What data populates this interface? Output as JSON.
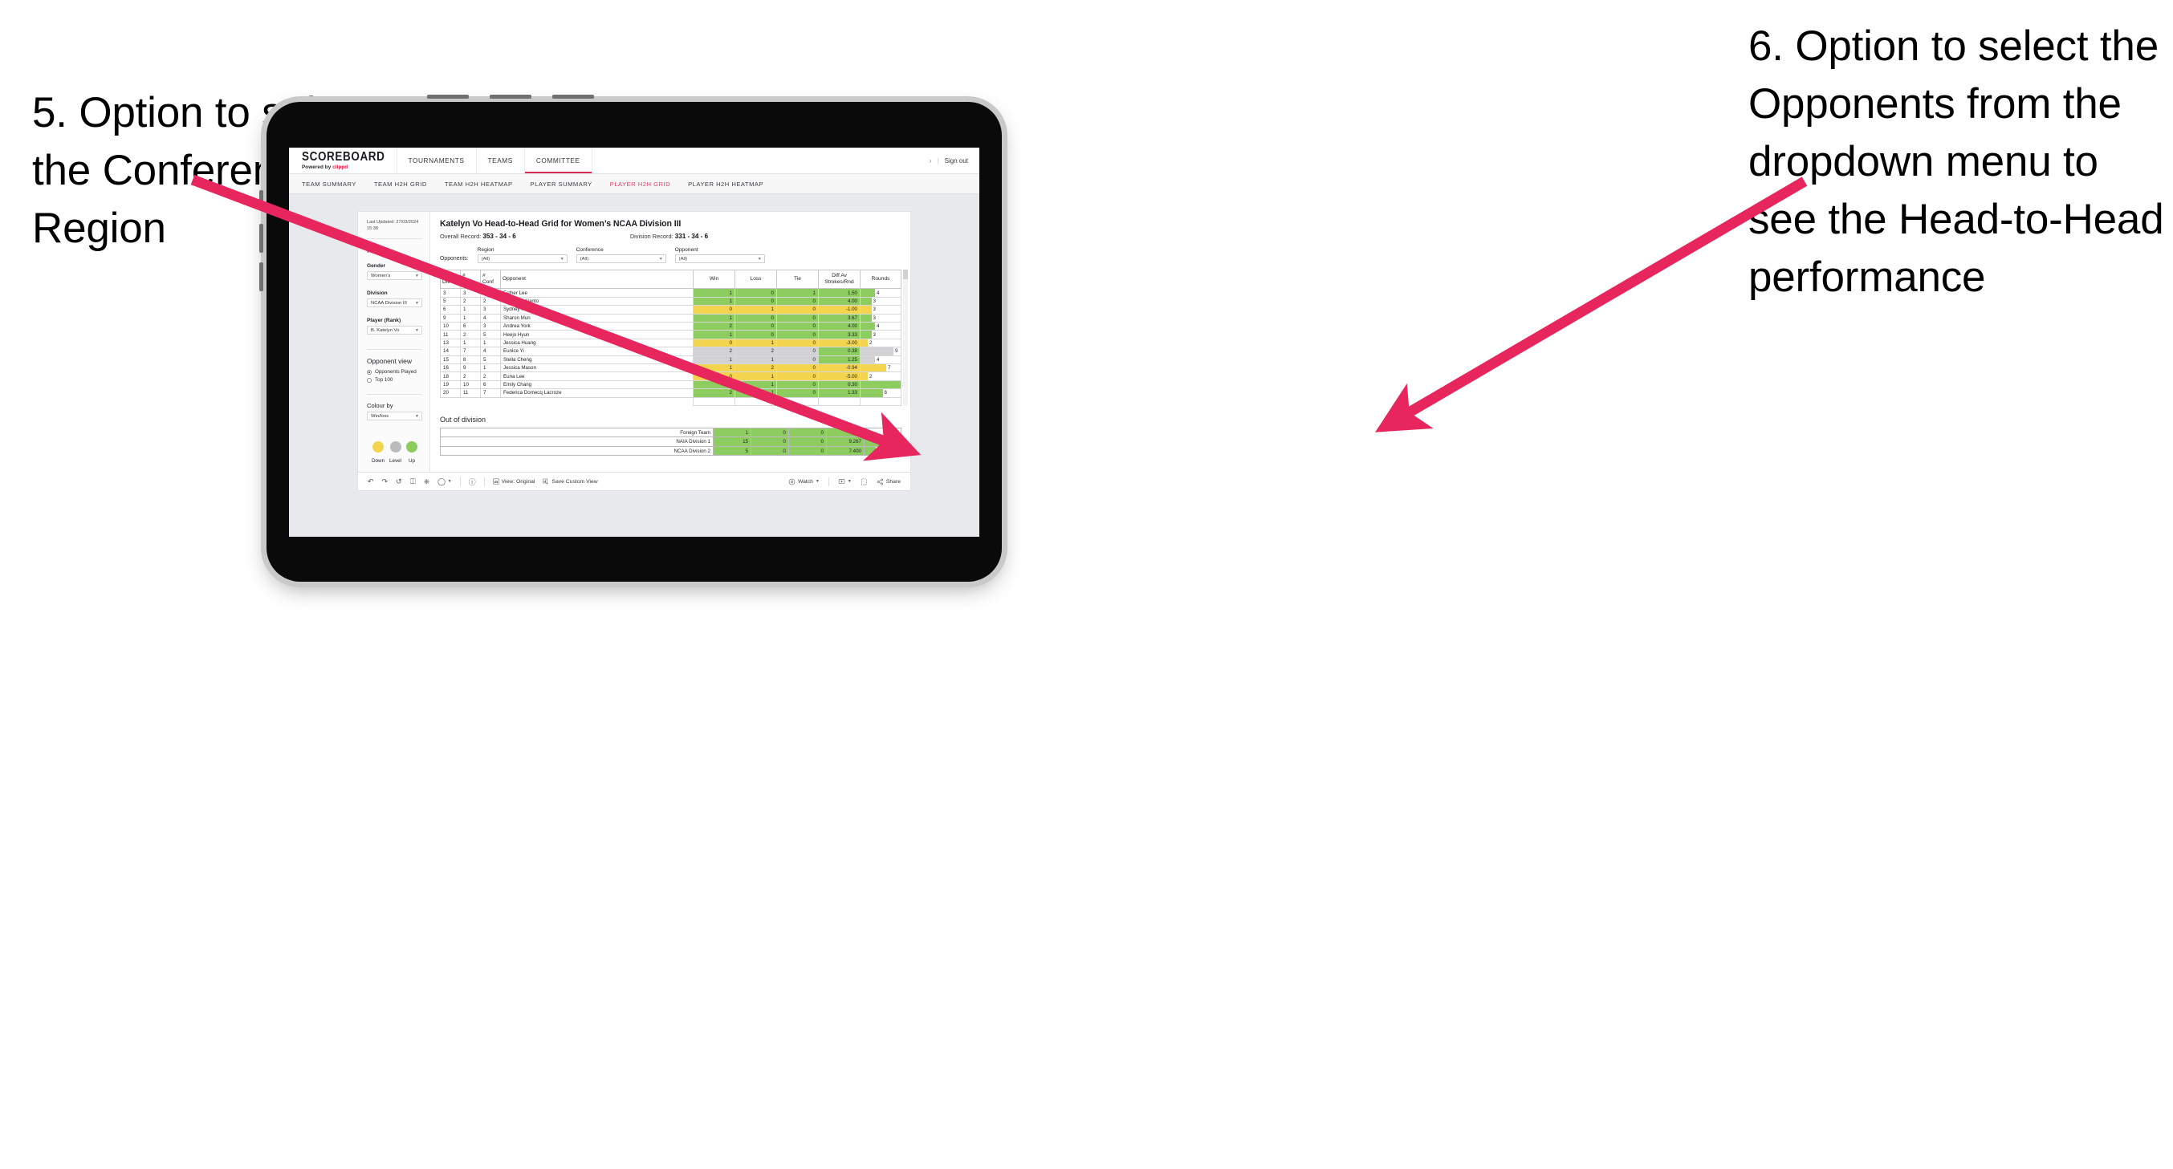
{
  "annotations": {
    "left": "5. Option to select the Conference and Region",
    "right": "6. Option to select the Opponents from the dropdown menu to see the Head-to-Head performance",
    "arrow_color": "#e8265e"
  },
  "app": {
    "logo": {
      "main": "SCOREBOARD",
      "powered": "Powered by",
      "brand": "clippd"
    },
    "header_tabs": [
      {
        "label": "TOURNAMENTS",
        "active": false
      },
      {
        "label": "TEAMS",
        "active": false
      },
      {
        "label": "COMMITTEE",
        "active": true
      }
    ],
    "header_right": {
      "chevron": "›",
      "separator": "|",
      "signout": "Sign out"
    },
    "subnav": [
      {
        "label": "TEAM SUMMARY",
        "active": false
      },
      {
        "label": "TEAM H2H GRID",
        "active": false
      },
      {
        "label": "TEAM H2H HEATMAP",
        "active": false
      },
      {
        "label": "PLAYER SUMMARY",
        "active": false
      },
      {
        "label": "PLAYER H2H GRID",
        "active": true
      },
      {
        "label": "PLAYER H2H HEATMAP",
        "active": false
      }
    ],
    "accent": "#e8234a"
  },
  "sidebar": {
    "last_updated": "Last Updated: 27/03/2024 15:38",
    "section_player": "Player",
    "gender": {
      "label": "Gender",
      "value": "Women’s"
    },
    "division": {
      "label": "Division",
      "value": "NCAA Division III"
    },
    "player_rank": {
      "label": "Player (Rank)",
      "value": "B. Katelyn Vo"
    },
    "opponent_view": {
      "title": "Opponent view",
      "options": [
        {
          "label": "Opponents Played",
          "selected": true
        },
        {
          "label": "Top 100",
          "selected": false
        }
      ]
    },
    "colour_by": {
      "label": "Colour by",
      "value": "Win/loss"
    },
    "legend": [
      {
        "label": "Down",
        "color": "#f2d44f"
      },
      {
        "label": "Level",
        "color": "#b9bbbd"
      },
      {
        "label": "Up",
        "color": "#8dcc5f"
      }
    ]
  },
  "main": {
    "title": "Katelyn Vo Head-to-Head Grid for Women’s NCAA Division III",
    "overall_record_label": "Overall Record:",
    "overall_record_value": "353 - 34 - 6",
    "division_record_label": "Division Record:",
    "division_record_value": "331 - 34 - 6",
    "filters_prefix": "Opponents:",
    "filters": [
      {
        "label": "Region",
        "value": "(All)"
      },
      {
        "label": "Conference",
        "value": "(All)"
      },
      {
        "label": "Opponent",
        "value": "(All)"
      }
    ],
    "columns": [
      {
        "top": "#",
        "bottom": "Div"
      },
      {
        "top": "#",
        "bottom": "Reg"
      },
      {
        "top": "#",
        "bottom": "Conf"
      },
      {
        "top": "",
        "bottom": "Opponent"
      },
      {
        "top": "",
        "bottom": "Win"
      },
      {
        "top": "",
        "bottom": "Loss"
      },
      {
        "top": "",
        "bottom": "Tie"
      },
      {
        "top": "Diff Av",
        "bottom": "Strokes/Rnd"
      },
      {
        "top": "",
        "bottom": "Rounds"
      }
    ],
    "rows": [
      {
        "div": "3",
        "reg": "3",
        "conf": "1",
        "opponent": "Esther Lee",
        "win": "1",
        "loss": "0",
        "tie": "1",
        "diff": "1.50",
        "rounds": "4",
        "color": "#8dcc5f",
        "bar_pct": 36
      },
      {
        "div": "5",
        "reg": "2",
        "conf": "2",
        "opponent": "Alexis Sudjianto",
        "win": "1",
        "loss": "0",
        "tie": "0",
        "diff": "4.00",
        "rounds": "3",
        "color": "#8dcc5f",
        "bar_pct": 27
      },
      {
        "div": "6",
        "reg": "1",
        "conf": "3",
        "opponent": "Sydney Kuo",
        "win": "0",
        "loss": "1",
        "tie": "0",
        "diff": "-1.00",
        "rounds": "3",
        "color": "#f2d44f",
        "bar_pct": 27
      },
      {
        "div": "9",
        "reg": "1",
        "conf": "4",
        "opponent": "Sharon Mun",
        "win": "1",
        "loss": "0",
        "tie": "0",
        "diff": "3.67",
        "rounds": "3",
        "color": "#8dcc5f",
        "bar_pct": 27
      },
      {
        "div": "10",
        "reg": "6",
        "conf": "3",
        "opponent": "Andrea York",
        "win": "2",
        "loss": "0",
        "tie": "0",
        "diff": "4.00",
        "rounds": "4",
        "color": "#8dcc5f",
        "bar_pct": 36
      },
      {
        "div": "11",
        "reg": "2",
        "conf": "5",
        "opponent": "Heejo Hyun",
        "win": "1",
        "loss": "0",
        "tie": "0",
        "diff": "3.33",
        "rounds": "3",
        "color": "#8dcc5f",
        "bar_pct": 27
      },
      {
        "div": "13",
        "reg": "1",
        "conf": "1",
        "opponent": "Jessica Huang",
        "win": "0",
        "loss": "1",
        "tie": "0",
        "diff": "-3.00",
        "rounds": "2",
        "color": "#f2d44f",
        "bar_pct": 18
      },
      {
        "div": "14",
        "reg": "7",
        "conf": "4",
        "opponent": "Eunice Yi",
        "win": "2",
        "loss": "2",
        "tie": "0",
        "diff": "0.38",
        "rounds": "9",
        "color": "#d2d2d4",
        "diff_color": "#8dcc5f",
        "bar_pct": 82
      },
      {
        "div": "15",
        "reg": "8",
        "conf": "5",
        "opponent": "Stella Cheng",
        "win": "1",
        "loss": "1",
        "tie": "0",
        "diff": "1.25",
        "rounds": "4",
        "color": "#d2d2d4",
        "diff_color": "#8dcc5f",
        "bar_pct": 36
      },
      {
        "div": "16",
        "reg": "9",
        "conf": "1",
        "opponent": "Jessica Mason",
        "win": "1",
        "loss": "2",
        "tie": "0",
        "diff": "-0.94",
        "rounds": "7",
        "color": "#f2d44f",
        "bar_pct": 64
      },
      {
        "div": "18",
        "reg": "2",
        "conf": "2",
        "opponent": "Euna Lee",
        "win": "0",
        "loss": "1",
        "tie": "0",
        "diff": "-5.00",
        "rounds": "2",
        "color": "#f2d44f",
        "bar_pct": 18
      },
      {
        "div": "19",
        "reg": "10",
        "conf": "6",
        "opponent": "Emily Chang",
        "win": "4",
        "loss": "1",
        "tie": "0",
        "diff": "0.30",
        "rounds": "11",
        "color": "#8dcc5f",
        "bar_pct": 100
      },
      {
        "div": "20",
        "reg": "11",
        "conf": "7",
        "opponent": "Federica Domecq Lacroze",
        "win": "2",
        "loss": "1",
        "tie": "0",
        "diff": "1.33",
        "rounds": "6",
        "color": "#8dcc5f",
        "bar_pct": 55
      }
    ],
    "out_of_division": {
      "title": "Out of division",
      "rows": [
        {
          "name": "Foreign Team",
          "win": "1",
          "loss": "0",
          "tie": "0",
          "diff": "4.500",
          "rounds": "2",
          "color": "#8dcc5f",
          "bar_pct": 6
        },
        {
          "name": "NAIA Division 1",
          "win": "15",
          "loss": "0",
          "tie": "0",
          "diff": "9.267",
          "rounds": "30",
          "color": "#8dcc5f",
          "bar_pct": 90
        },
        {
          "name": "NCAA Division 2",
          "win": "5",
          "loss": "0",
          "tie": "0",
          "diff": "7.400",
          "rounds": "10",
          "color": "#8dcc5f",
          "bar_pct": 30
        }
      ]
    }
  },
  "toolbar": {
    "view_label": "View: Original",
    "save_label": "Save Custom View",
    "watch_label": "Watch",
    "share_label": "Share"
  }
}
